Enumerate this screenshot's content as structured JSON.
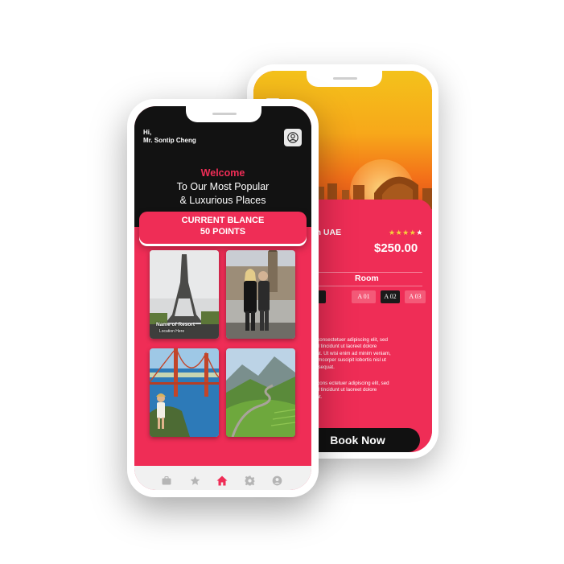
{
  "back_screen": {
    "back_icon": "chevron-left-icon",
    "hotel_line1": "el in UAE",
    "hotel_line2": "e",
    "rating_stars": 4,
    "rating_max": 5,
    "price": "$250.00",
    "room_heading": "Room",
    "chips": [
      {
        "label": "Floor",
        "selected": true
      },
      {
        "label": "A 01",
        "selected": false
      },
      {
        "label": "A 02",
        "selected": true
      },
      {
        "label": "A 03",
        "selected": false
      }
    ],
    "desc_para1": [
      "amet, consectetuer adipiscing elit, sed",
      "iusmod tincidunt ut laoreet dolore",
      "volutpat. Ut wisi enim ad minim veniam,",
      "on ullamcorper suscipit lobortis nisl ut",
      "do consequat."
    ],
    "desc_para2": [
      "amet, cons ectetuer adipiscing elit, sed",
      "iusmod tincidunt ut laoreet dolore",
      "volutpat."
    ],
    "book_label": "Book Now"
  },
  "front_screen": {
    "greeting_hi": "Hi,",
    "greeting_name": "Mr. Sontip Cheng",
    "profile_icon": "user-icon",
    "welcome_title": "Welcome",
    "welcome_line1": "To Our Most Popular",
    "welcome_line2": "& Luxurious Places",
    "balance_line1": "CURRENT BLANCE",
    "balance_line2": "50 POINTS",
    "tiles": [
      {
        "name": "Name of Resort",
        "location": "Location Here",
        "scene": "eiffel-tower"
      },
      {
        "scene": "couple-london"
      },
      {
        "scene": "golden-gate-bridge"
      },
      {
        "scene": "mountain-road"
      }
    ],
    "tabs": [
      {
        "icon": "briefcase-icon",
        "active": false
      },
      {
        "icon": "star-icon",
        "active": false
      },
      {
        "icon": "home-icon",
        "active": true
      },
      {
        "icon": "gear-icon",
        "active": false
      },
      {
        "icon": "user-icon",
        "active": false
      }
    ]
  },
  "colors": {
    "accent": "#ef2d56",
    "dark": "#121212",
    "star": "#f6d23c",
    "tabbar": "#f1f1f1",
    "tab_inactive": "#b5b5b5"
  }
}
